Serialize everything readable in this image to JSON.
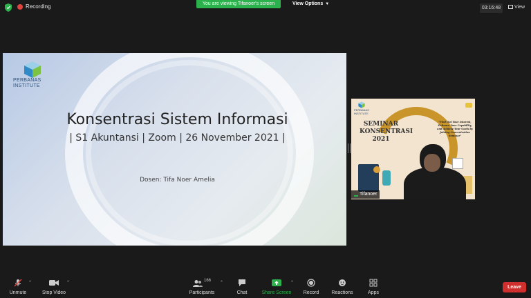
{
  "topbar": {
    "recording_label": "Recording",
    "viewing_banner": "You are viewing Tifanoer's screen",
    "view_options_label": "View Options",
    "timer": "03:16:48",
    "view_label": "View"
  },
  "slide": {
    "logo_line1": "PERBANAS",
    "logo_line2": "INSTITUTE",
    "title": "Konsentrasi Sistem Informasi",
    "subtitle": "| S1 Akuntansi | Zoom | 26 November 2021 |",
    "dosen": "Dosen: Tifa Noer Amelia"
  },
  "video": {
    "logo_line1": "PERBANAS",
    "logo_line2": "INSTITUTE",
    "seminar_line1": "SEMINAR",
    "seminar_line2": "KONSENTRASI",
    "seminar_line3": "2021",
    "quote": "\"Find Out Your Interest, Enhance Your Capability, and Achieve Your Goals by Joining Concentration Seminar\"",
    "participant_name": "Tifanoer"
  },
  "toolbar": {
    "unmute": "Unmute",
    "stop_video": "Stop Video",
    "participants": "Participants",
    "participants_count": "166",
    "chat": "Chat",
    "share_screen": "Share Screen",
    "record": "Record",
    "reactions": "Reactions",
    "apps": "Apps",
    "leave": "Leave"
  },
  "colors": {
    "background": "#1a1a1a",
    "banner_green": "#2bb24c",
    "leave_red": "#d0302d",
    "record_red": "#e0443c"
  },
  "icons": [
    "shield-icon",
    "record-dot-icon",
    "chevron-down-icon",
    "grid-view-icon",
    "mic-muted-icon",
    "video-camera-icon",
    "participants-icon",
    "chat-icon",
    "share-screen-icon",
    "record-icon",
    "reactions-icon",
    "apps-icon"
  ]
}
